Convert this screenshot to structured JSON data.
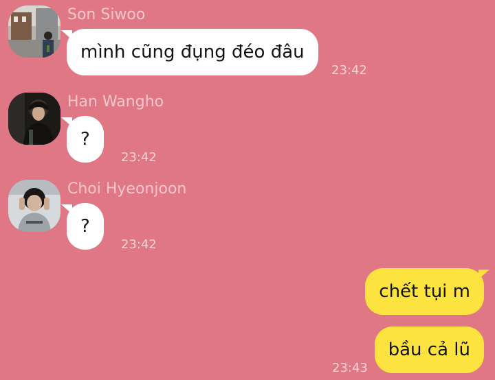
{
  "messages": [
    {
      "sender": "Son Siwoo",
      "text": "mình cũng đụng đéo đâu",
      "time": "23:42"
    },
    {
      "sender": "Han Wangho",
      "text": "?",
      "time": "23:42"
    },
    {
      "sender": "Choi Hyeonjoon",
      "text": "?",
      "time": "23:42"
    }
  ],
  "outgoing": [
    {
      "text": "chết tụi m",
      "time": ""
    },
    {
      "text": "bầu cả lũ",
      "time": "23:43"
    }
  ],
  "colors": {
    "background": "#e07785",
    "incoming_bubble": "#ffffff",
    "outgoing_bubble": "#fde33f",
    "sender_name": "#f8c6cd",
    "timestamp": "#f6d2d7"
  }
}
